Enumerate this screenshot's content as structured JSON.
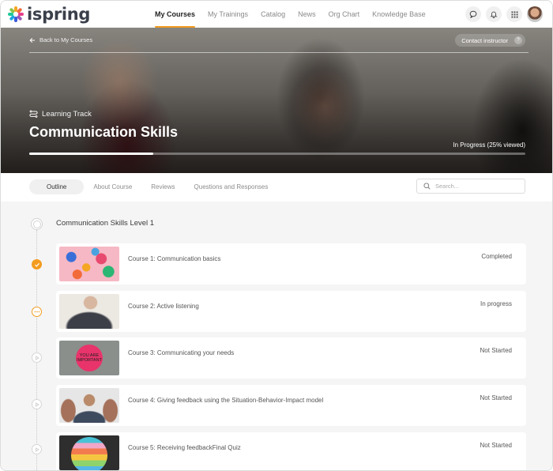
{
  "app": {
    "logo_text": "ispring",
    "brand_color": "#f39c1f"
  },
  "nav": {
    "items": [
      {
        "label": "My Courses",
        "active": true
      },
      {
        "label": "My Trainings",
        "active": false
      },
      {
        "label": "Catalog",
        "active": false
      },
      {
        "label": "News",
        "active": false
      },
      {
        "label": "Org Chart",
        "active": false
      },
      {
        "label": "Knowledge Base",
        "active": false
      }
    ],
    "icons": [
      "chat-icon",
      "bell-icon",
      "apps-grid-icon",
      "user-avatar"
    ]
  },
  "hero": {
    "back_label": "Back to My Courses",
    "contact_label": "Contact instructor",
    "contact_help": "?",
    "type_label": "Learning Track",
    "title": "Communication Skills",
    "status": "In Progress (25% viewed)",
    "progress_percent": 25
  },
  "tabs": [
    {
      "label": "Outline",
      "active": true
    },
    {
      "label": "About Course",
      "active": false
    },
    {
      "label": "Reviews",
      "active": false
    },
    {
      "label": "Questions and Responses",
      "active": false
    }
  ],
  "search": {
    "placeholder": "Search...",
    "value": ""
  },
  "outline": {
    "section_title": "Communication Skills Level 1",
    "courses": [
      {
        "title": "Course 1: Communication basics",
        "status": "Completed",
        "state": "done",
        "thumb": "colorful-letters"
      },
      {
        "title": "Course 2: Active listening",
        "status": "In progress",
        "state": "progress",
        "thumb": "man-with-glasses"
      },
      {
        "title": "Course 3: Communicating your needs",
        "status": "Not Started",
        "state": "pending",
        "thumb": "you-are-important-sign",
        "thumb_text": "YOU ARE IMPORTANT"
      },
      {
        "title": "Course 4: Giving feedback using the Situation-Behavior-Impact model",
        "status": "Not Started",
        "state": "pending",
        "thumb": "thumbs-up-man"
      },
      {
        "title": "Course 5: Receiving feedbackFinal Quiz",
        "status": "Not Started",
        "state": "pending",
        "thumb": "rainbow-smiley"
      }
    ]
  }
}
